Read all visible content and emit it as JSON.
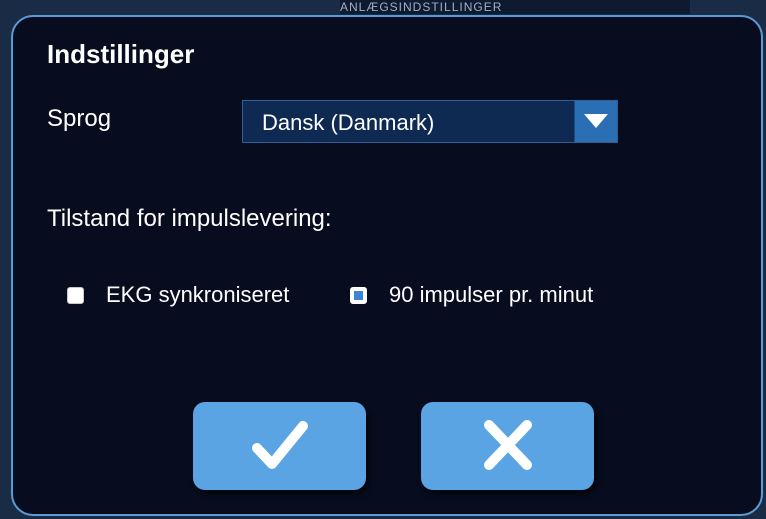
{
  "backdrop": {
    "strip_text": "ANLÆGSINDSTILLINGER"
  },
  "dialog": {
    "title": "Indstillinger",
    "language": {
      "label": "Sprog",
      "selected": "Dansk (Danmark)"
    },
    "delivery_mode": {
      "label": "Tilstand for impulslevering:",
      "options": [
        {
          "label": "EKG synkroniseret",
          "checked": false
        },
        {
          "label": "90 impulser pr. minut",
          "checked": true
        }
      ]
    },
    "buttons": {
      "confirm_icon": "checkmark-icon",
      "cancel_icon": "close-icon"
    }
  },
  "colors": {
    "dialog_bg": "#070d1e",
    "accent": "#5aa4e3",
    "border": "#5b9bd5"
  }
}
